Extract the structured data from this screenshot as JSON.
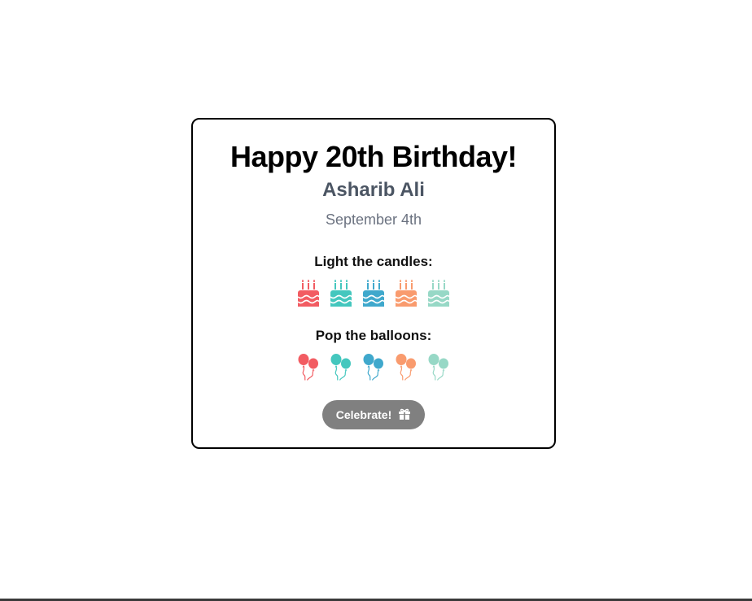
{
  "card": {
    "title": "Happy 20th Birthday!",
    "name": "Asharib Ali",
    "date": "September 4th"
  },
  "candles": {
    "label": "Light the candles:",
    "icon": "birthday-cake-icon",
    "colors": [
      "#f25c62",
      "#44c7be",
      "#3fa8cc",
      "#f99b6e",
      "#97d8c6"
    ]
  },
  "balloons": {
    "label": "Pop the balloons:",
    "icon": "balloons-icon",
    "colors": [
      "#f25c62",
      "#44c7be",
      "#3fa8cc",
      "#f99b6e",
      "#97d8c6"
    ]
  },
  "celebrate": {
    "label": "Celebrate!",
    "icon": "gift-icon",
    "background": "#808080"
  }
}
